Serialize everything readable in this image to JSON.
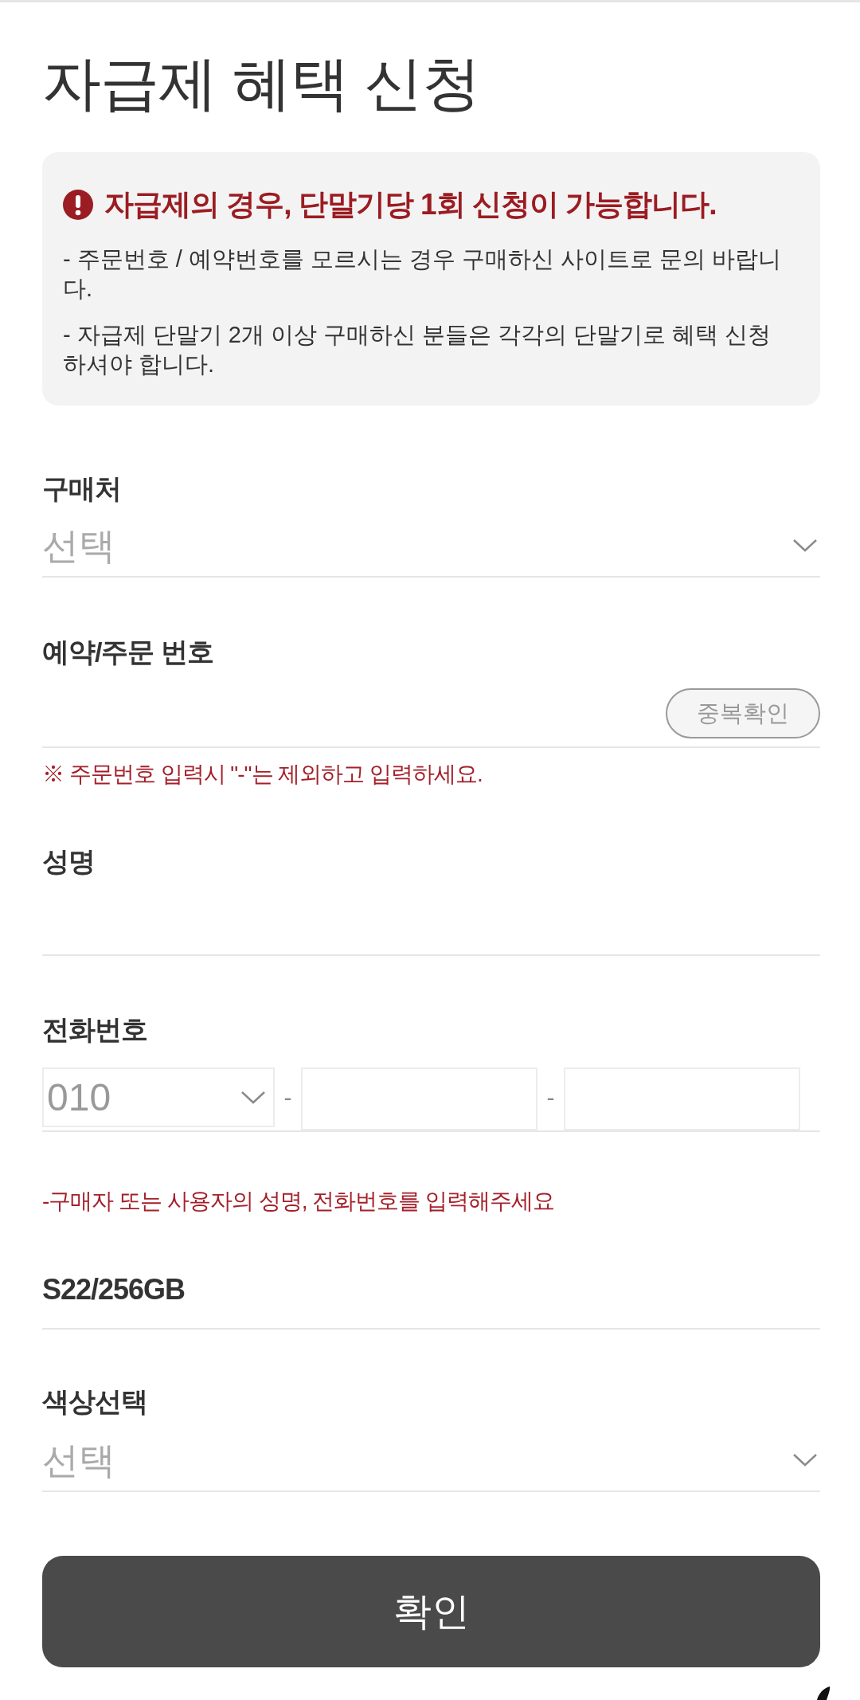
{
  "page": {
    "title": "자급제 혜택 신청"
  },
  "notice": {
    "heading": "자급제의 경우, 단말기당 1회 신청이 가능합니다.",
    "lines": [
      "- 주문번호 / 예약번호를 모르시는 경우 구매하신 사이트로 문의 바랍니다.",
      "- 자급제 단말기 2개 이상 구매하신 분들은 각각의 단말기로 혜택 신청 하셔야 합니다."
    ]
  },
  "form": [
    {
      "kind": "select",
      "label": "구매처",
      "placeholder": "선택"
    },
    {
      "kind": "input_button",
      "label": "예약/주문 번호",
      "button": "중복확인",
      "note": "※ 주문번호 입력시 \"-\"는 제외하고 입력하세요."
    },
    {
      "kind": "input",
      "label": "성명"
    },
    {
      "kind": "phone",
      "label": "전화번호",
      "prefix": "010",
      "separators": [
        "-",
        "-"
      ],
      "note": "-구매자 또는 사용자의 성명, 전화번호를 입력해주세요"
    },
    {
      "kind": "product",
      "value": "S22/256GB"
    },
    {
      "kind": "select",
      "label": "색상선택",
      "placeholder": "선택"
    }
  ],
  "submit": {
    "label": "확인"
  }
}
